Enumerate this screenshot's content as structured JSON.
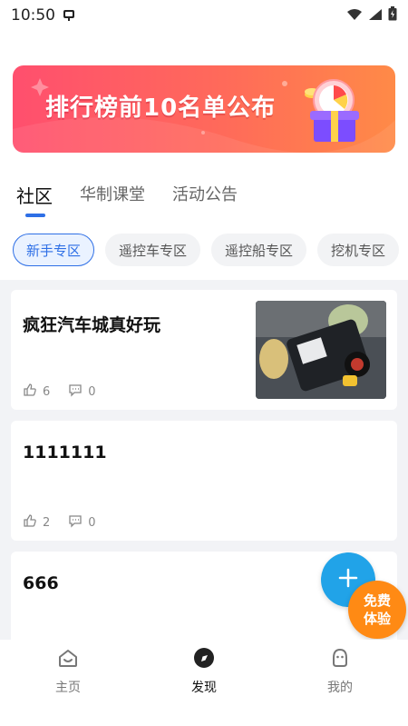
{
  "statusbar": {
    "time": "10:50",
    "app_icon": "app-notification-icon",
    "icons": [
      "wifi-icon",
      "signal-icon",
      "battery-icon"
    ]
  },
  "banner": {
    "text": "排行榜前10名单公布",
    "icon": "gift-box-icon",
    "colors": {
      "start": "#ff4f6e",
      "end": "#ff8a47"
    }
  },
  "tabs": [
    {
      "label": "社区",
      "active": true
    },
    {
      "label": "华制课堂",
      "active": false
    },
    {
      "label": "活动公告",
      "active": false
    }
  ],
  "chips": [
    {
      "label": "新手专区",
      "active": true
    },
    {
      "label": "遥控车专区",
      "active": false
    },
    {
      "label": "遥控船专区",
      "active": false
    },
    {
      "label": "挖机专区",
      "active": false
    }
  ],
  "posts": [
    {
      "title": "疯狂汽车城真好玩",
      "likes": "6",
      "comments": "0",
      "has_image": true
    },
    {
      "title": "1111111",
      "likes": "2",
      "comments": "0",
      "has_image": false
    },
    {
      "title": "666",
      "likes": "",
      "comments": "",
      "has_image": false
    }
  ],
  "fab": {
    "add_icon": "plus-icon",
    "trial_line1": "免费",
    "trial_line2": "体验"
  },
  "bottom_nav": [
    {
      "label": "主页",
      "icon": "home-icon",
      "active": false
    },
    {
      "label": "发现",
      "icon": "discover-icon",
      "active": true
    },
    {
      "label": "我的",
      "icon": "profile-icon",
      "active": false
    }
  ],
  "colors": {
    "accent": "#2e6fe6",
    "fab_blue": "#21a3e8",
    "fab_orange": "#ff8a14",
    "feed_bg": "#f2f3f6"
  }
}
